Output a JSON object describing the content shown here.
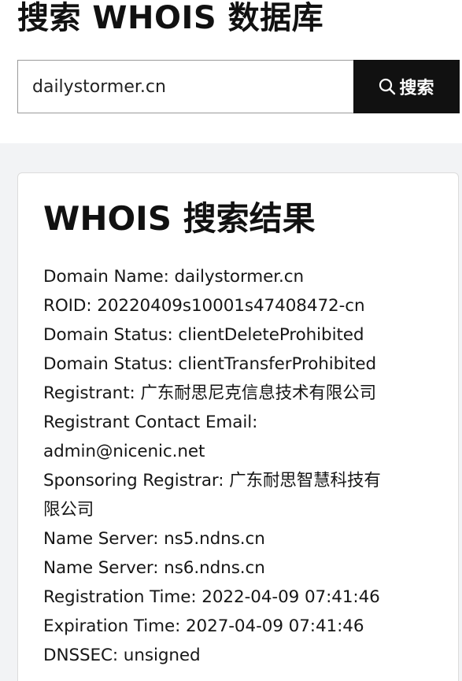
{
  "page": {
    "title": "搜索 WHOIS 数据库"
  },
  "search": {
    "value": "dailystormer.cn",
    "button_label": "搜索",
    "button_icon": "search-icon"
  },
  "results": {
    "title": "WHOIS 搜索结果",
    "lines": [
      "Domain Name: dailystormer.cn",
      "ROID: 20220409s10001s47408472-cn",
      "Domain Status: clientDeleteProhibited",
      "Domain Status: clientTransferProhibited",
      "Registrant: 广东耐思尼克信息技术有限公司",
      "Registrant Contact Email:",
      "admin@nicenic.net",
      "Sponsoring Registrar: 广东耐思智慧科技有",
      "限公司",
      "Name Server: ns5.ndns.cn",
      "Name Server: ns6.ndns.cn",
      "Registration Time: 2022-04-09 07:41:46",
      "Expiration Time: 2027-04-09 07:41:46",
      "DNSSEC: unsigned"
    ]
  },
  "colors": {
    "button_background": "#111111",
    "page_background": "#f2f3f5",
    "card_background": "#ffffff"
  }
}
